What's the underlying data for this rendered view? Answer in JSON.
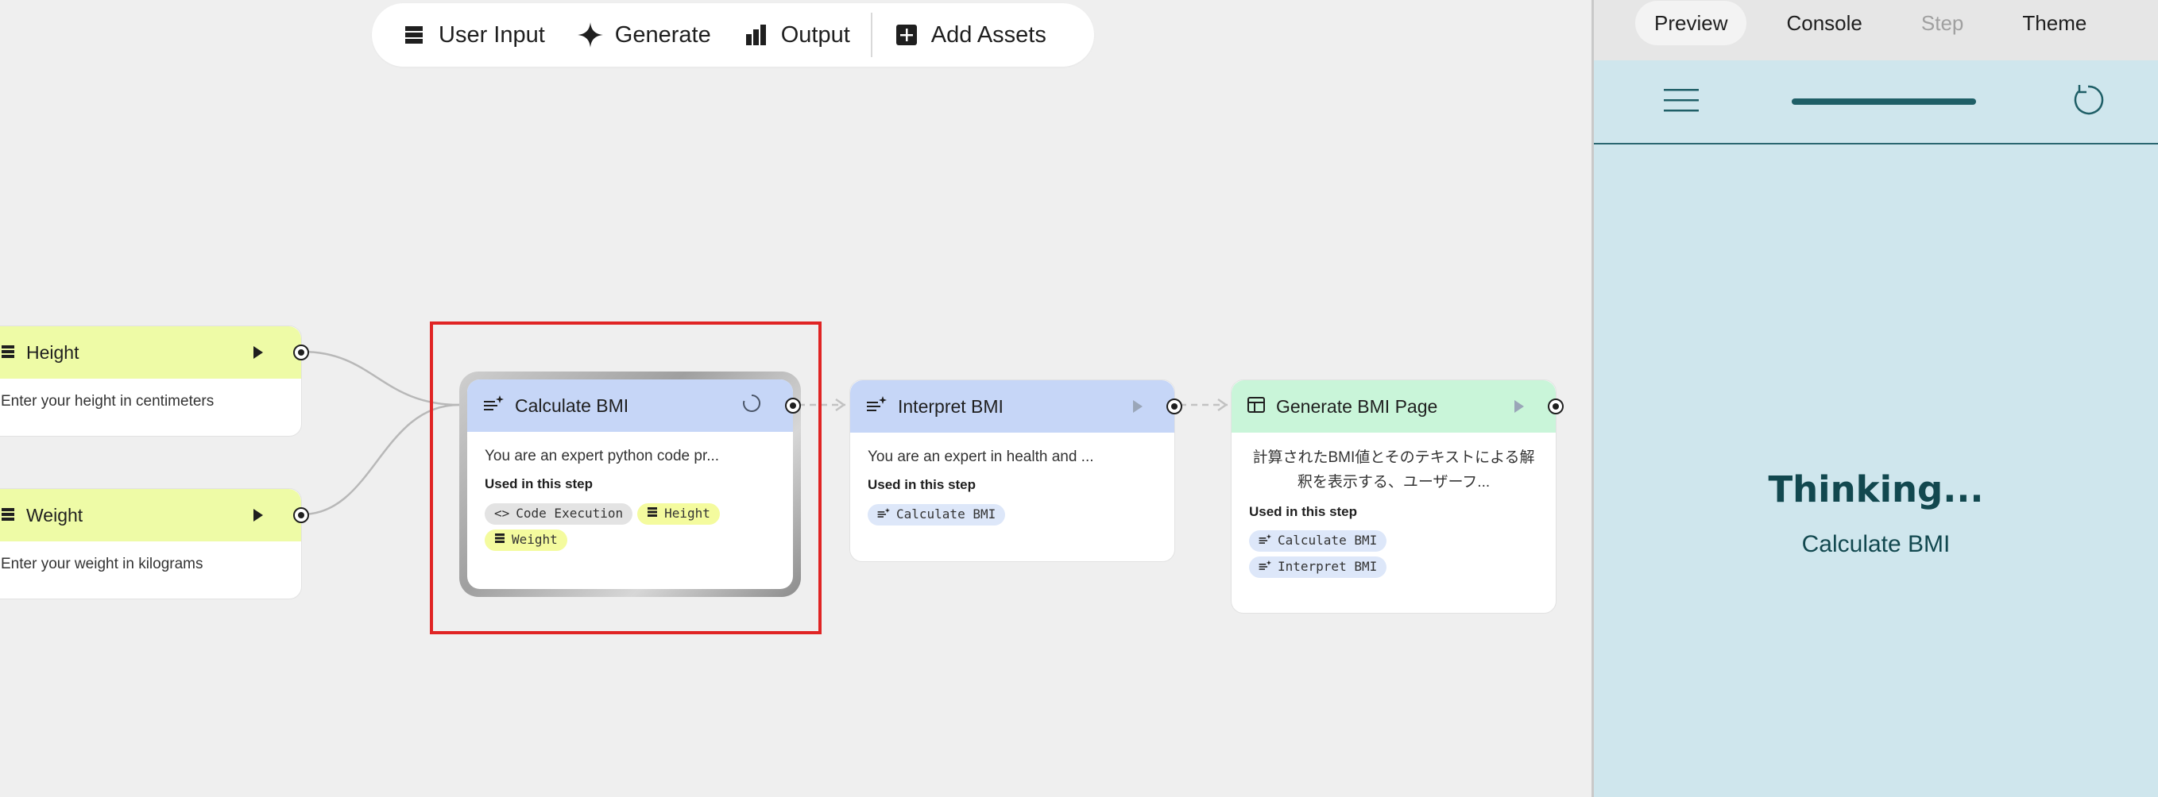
{
  "toolbar": {
    "items": [
      {
        "label": "User Input",
        "icon": "user-input-icon"
      },
      {
        "label": "Generate",
        "icon": "sparkle-icon"
      },
      {
        "label": "Output",
        "icon": "output-icon"
      },
      {
        "label": "Add Assets",
        "icon": "add-box-icon"
      }
    ]
  },
  "nodes": {
    "height": {
      "title": "Height",
      "body": "Enter your height in centimeters"
    },
    "weight": {
      "title": "Weight",
      "body": "Enter your weight in kilograms"
    },
    "calc": {
      "title": "Calculate BMI",
      "body": "You are an expert python code pr...",
      "used_label": "Used in this step",
      "chips": [
        "Code Execution",
        "Height",
        "Weight"
      ]
    },
    "interpret": {
      "title": "Interpret BMI",
      "body": "You are an expert in health and ...",
      "used_label": "Used in this step",
      "chips": [
        "Calculate BMI"
      ]
    },
    "page": {
      "title": "Generate BMI Page",
      "body": "計算されたBMI値とそのテキストによる解釈を表示する、ユーザーフ...",
      "used_label": "Used in this step",
      "chips": [
        "Calculate BMI",
        "Interpret BMI"
      ]
    }
  },
  "panel": {
    "tabs": [
      {
        "label": "Preview",
        "state": "active"
      },
      {
        "label": "Console",
        "state": "normal"
      },
      {
        "label": "Step",
        "state": "disabled"
      },
      {
        "label": "Theme",
        "state": "normal"
      }
    ],
    "status": "Thinking...",
    "status_sub": "Calculate BMI"
  },
  "colors": {
    "input_head": "#eefba6",
    "generate_head": "#c6d6f7",
    "output_head": "#c9f5d9",
    "panel_bg": "#cfe6ed",
    "panel_text": "#12484f",
    "selection": "#e02424"
  }
}
